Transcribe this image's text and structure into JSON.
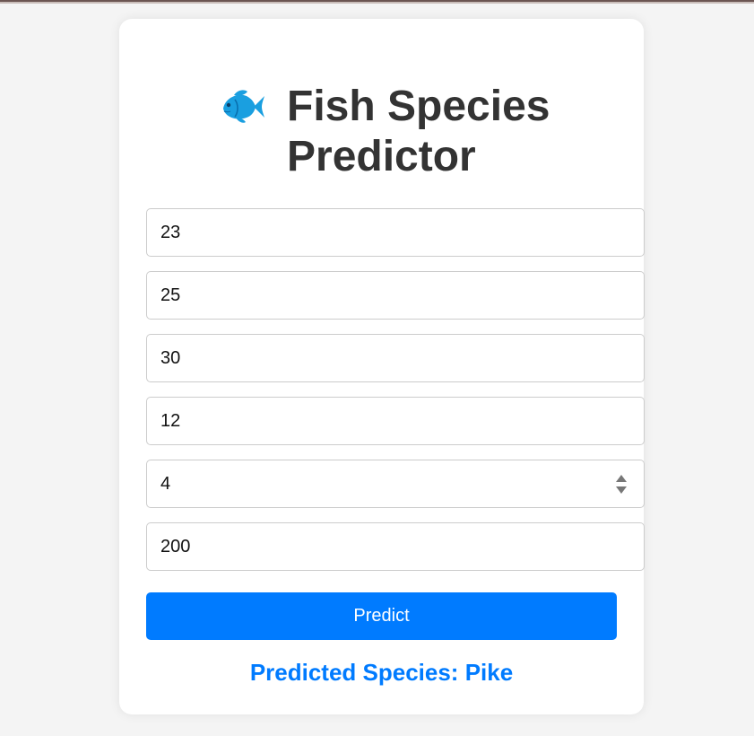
{
  "page": {
    "title": "Fish Species Predictor",
    "icon": "fish-icon"
  },
  "form": {
    "fields": [
      {
        "value": "23"
      },
      {
        "value": "25"
      },
      {
        "value": "30"
      },
      {
        "value": "12"
      },
      {
        "value": "4"
      },
      {
        "value": "200"
      }
    ],
    "button_label": "Predict"
  },
  "result": {
    "text": "Predicted Species: Pike"
  },
  "colors": {
    "accent": "#007bff",
    "title": "#333333",
    "background": "#f4f4f4",
    "fish": "#1a9fe0"
  }
}
